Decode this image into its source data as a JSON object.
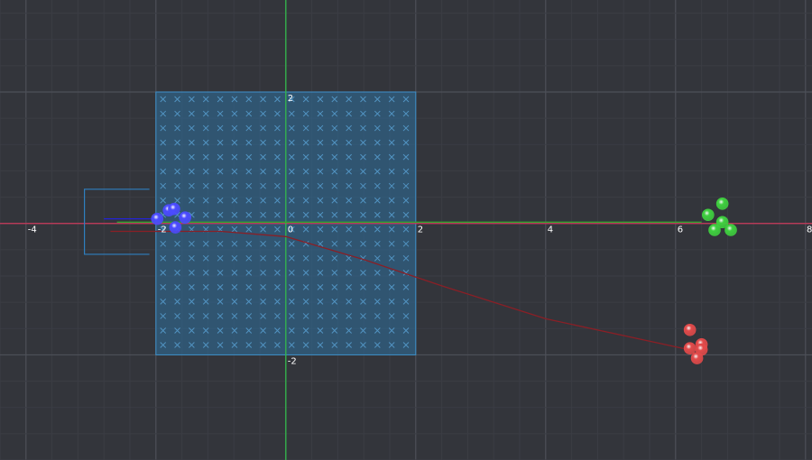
{
  "scene": {
    "x_range": [
      -4.4,
      8.1
    ],
    "y_range": [
      -3.6,
      3.4
    ],
    "minor_step": 0.4,
    "major_step": 2,
    "colors": {
      "background": "#33353b",
      "minor_grid": "#3b3d44",
      "major_grid": "#4d5058",
      "x_axis": "#c8385a",
      "y_axis": "#32b74a",
      "magnetic_field_fill": "#2e6f9e",
      "magnetic_field_border": "#3c8ec8",
      "field_marker": "#5aa2d6",
      "emitter_bracket": "#2f7fbf",
      "blue_particle": "#4b4bff",
      "green_particle": "#3fd03f",
      "red_particle": "#e24a4a",
      "blue_trail": "#2323d8",
      "green_trail": "#2fa32f",
      "red_trail": "#8a1f26"
    },
    "axis_ticks": {
      "x": [
        "-4",
        "-2",
        "0",
        "2",
        "4",
        "6",
        "8"
      ],
      "y": [
        "2",
        "-2"
      ]
    },
    "magnetic_field": {
      "x_range": [
        -2,
        2
      ],
      "y_range": [
        -2,
        2
      ],
      "marker_symbol": "×",
      "marker_spacing": 0.22
    },
    "emitter": {
      "x_range": [
        -3.1,
        -2.1
      ],
      "y_range": [
        -0.47,
        0.52
      ]
    },
    "particle_groups": [
      {
        "name": "blue",
        "trail": [
          [
            -2.8,
            0.07
          ],
          [
            -1.9,
            0.07
          ]
        ],
        "particles": [
          [
            -1.98,
            0.07
          ],
          [
            -1.8,
            0.2
          ],
          [
            -1.72,
            0.22
          ],
          [
            -1.55,
            0.09
          ],
          [
            -1.7,
            -0.06
          ]
        ]
      },
      {
        "name": "green",
        "trail": [
          [
            -2.6,
            0.02
          ],
          [
            6.4,
            0.02
          ]
        ],
        "particles": [
          [
            6.5,
            0.13
          ],
          [
            6.72,
            0.3
          ],
          [
            6.72,
            0.02
          ],
          [
            6.6,
            -0.1
          ],
          [
            6.85,
            -0.1
          ]
        ]
      },
      {
        "name": "red",
        "trail": [
          [
            -2.7,
            -0.12
          ],
          [
            -1,
            -0.12
          ],
          [
            0,
            -0.2
          ],
          [
            1.2,
            -0.55
          ],
          [
            2.4,
            -0.95
          ],
          [
            4,
            -1.45
          ],
          [
            6.2,
            -1.92
          ]
        ],
        "particles": [
          [
            6.22,
            -1.62
          ],
          [
            6.4,
            -1.84
          ],
          [
            6.22,
            -1.9
          ],
          [
            6.33,
            -2.05
          ],
          [
            6.4,
            -1.92
          ]
        ]
      }
    ]
  }
}
